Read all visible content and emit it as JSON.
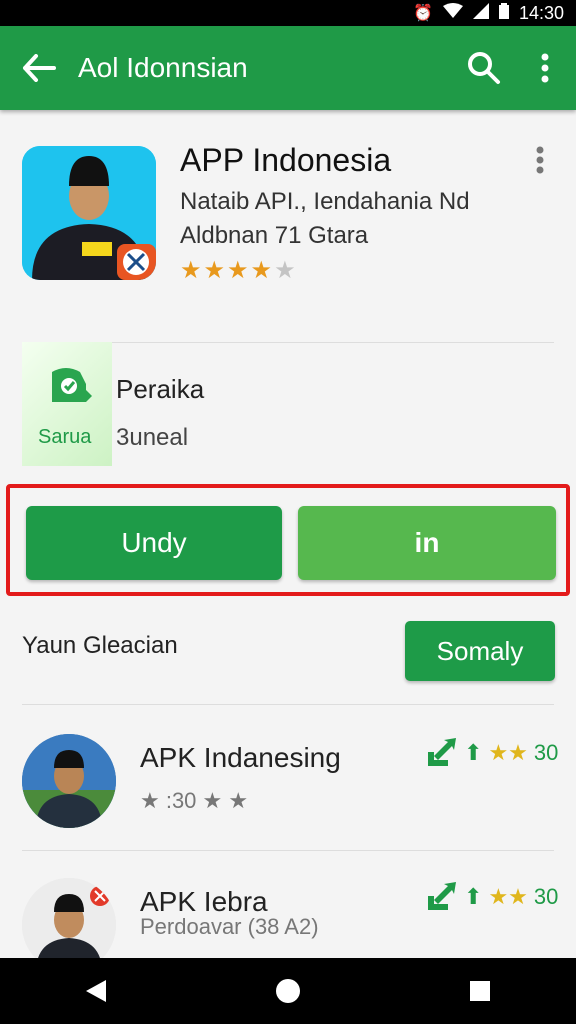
{
  "status_bar": {
    "time": "14:30"
  },
  "app_bar": {
    "title": "Aol Idonnsian"
  },
  "app": {
    "name": "APP Indonesia",
    "developer_line1": "Nataib API., Iendahania Nd",
    "developer_line2": "Aldbnan 71 Gtara",
    "rating_stars": 4
  },
  "info_card": {
    "thumb_label": "Sarua",
    "title": "Peraika",
    "subtitle": "3uneal"
  },
  "buttons": {
    "left_label": "Undy",
    "right_label": "in"
  },
  "similar": {
    "title": "Yaun Gleacian",
    "button_label": "Somaly"
  },
  "list": [
    {
      "name": "APK Indanesing",
      "rating_text": "★ :30 ★ ★",
      "score": "30"
    },
    {
      "name": "APK Iebra",
      "rating_text": "Perdoavar (38 A2)",
      "score": "30"
    }
  ],
  "colors": {
    "primary": "#1f9a47",
    "accent_light": "#56b84e",
    "highlight": "#e31b1b",
    "star": "#e8991d"
  }
}
